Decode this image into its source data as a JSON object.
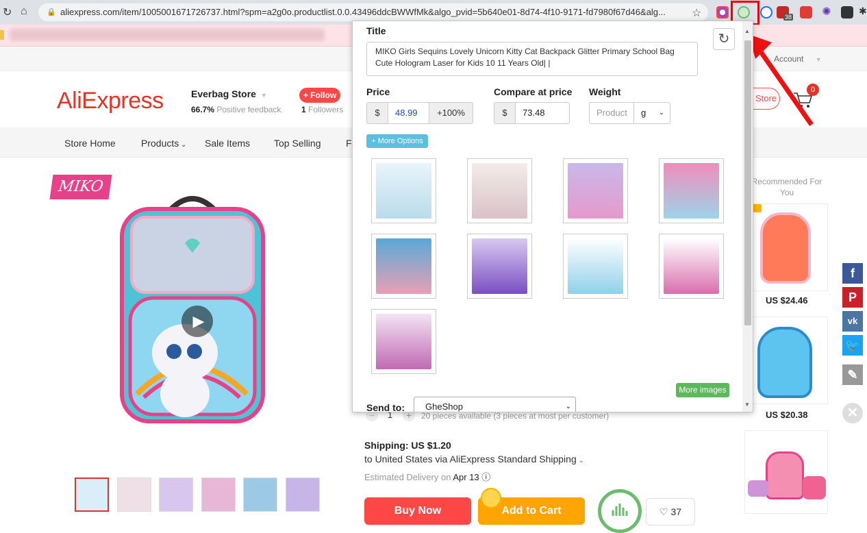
{
  "browser": {
    "url": "aliexpress.com/item/1005001671726737.html?spm=a2g0o.productlist.0.0.43496ddcBWWfMk&algo_pvid=5b640e01-8d74-4f10-9171-fd7980f67d46&alg...",
    "extension_badge": "38"
  },
  "site": {
    "logo": "AliExpress",
    "account_label": "Account",
    "cart_count": "0",
    "store_button": "Store"
  },
  "store": {
    "name": "Everbag Store",
    "positive_pct": "66.7%",
    "positive_label": "Positive feedback",
    "follow_label": "+ Follow",
    "followers_count": "1",
    "followers_label": "Followers"
  },
  "store_nav": {
    "items": [
      "Store Home",
      "Products",
      "Sale Items",
      "Top Selling",
      "Fe"
    ]
  },
  "brand_logo_text": "MIKO",
  "product": {
    "quantity": "1",
    "availability": "20 pieces available (3 pieces at most per customer)",
    "shipping_label": "Shipping: US $1.20",
    "shipping_detail": "to United States via AliExpress Standard Shipping",
    "delivery_prefix": "Estimated Delivery on",
    "delivery_date": "Apr 13",
    "buy_now": "Buy Now",
    "add_to_cart": "Add to Cart",
    "wishlist_count": "37"
  },
  "recommended": {
    "title": "Recommended For You",
    "prices": [
      "US $24.46",
      "US $20.38"
    ]
  },
  "popup": {
    "title_label": "Title",
    "title_value": "MIKO  Girls Sequins Lovely Unicorn Kitty Cat Backpack Glitter Primary School Bag Cute Hologram Laser for Kids 10 11 Years Old| |",
    "price_label": "Price",
    "price_currency": "$",
    "price_value": "48.99",
    "price_markup": "+100%",
    "compare_label": "Compare at price",
    "compare_currency": "$",
    "compare_value": "73.48",
    "weight_label": "Weight",
    "weight_placeholder": "Product",
    "weight_unit": "g",
    "more_options": "+ More Options",
    "more_images": "More images",
    "send_to_label": "Send to:",
    "send_to_value": "GheShop"
  },
  "colors": {
    "ali_red": "#e43225",
    "follow_red": "#ff4747",
    "more_options_blue": "#5bc0de",
    "more_images_green": "#5cb85c",
    "buy_now": "#ff4747",
    "add_to_cart": "#ffa400"
  }
}
